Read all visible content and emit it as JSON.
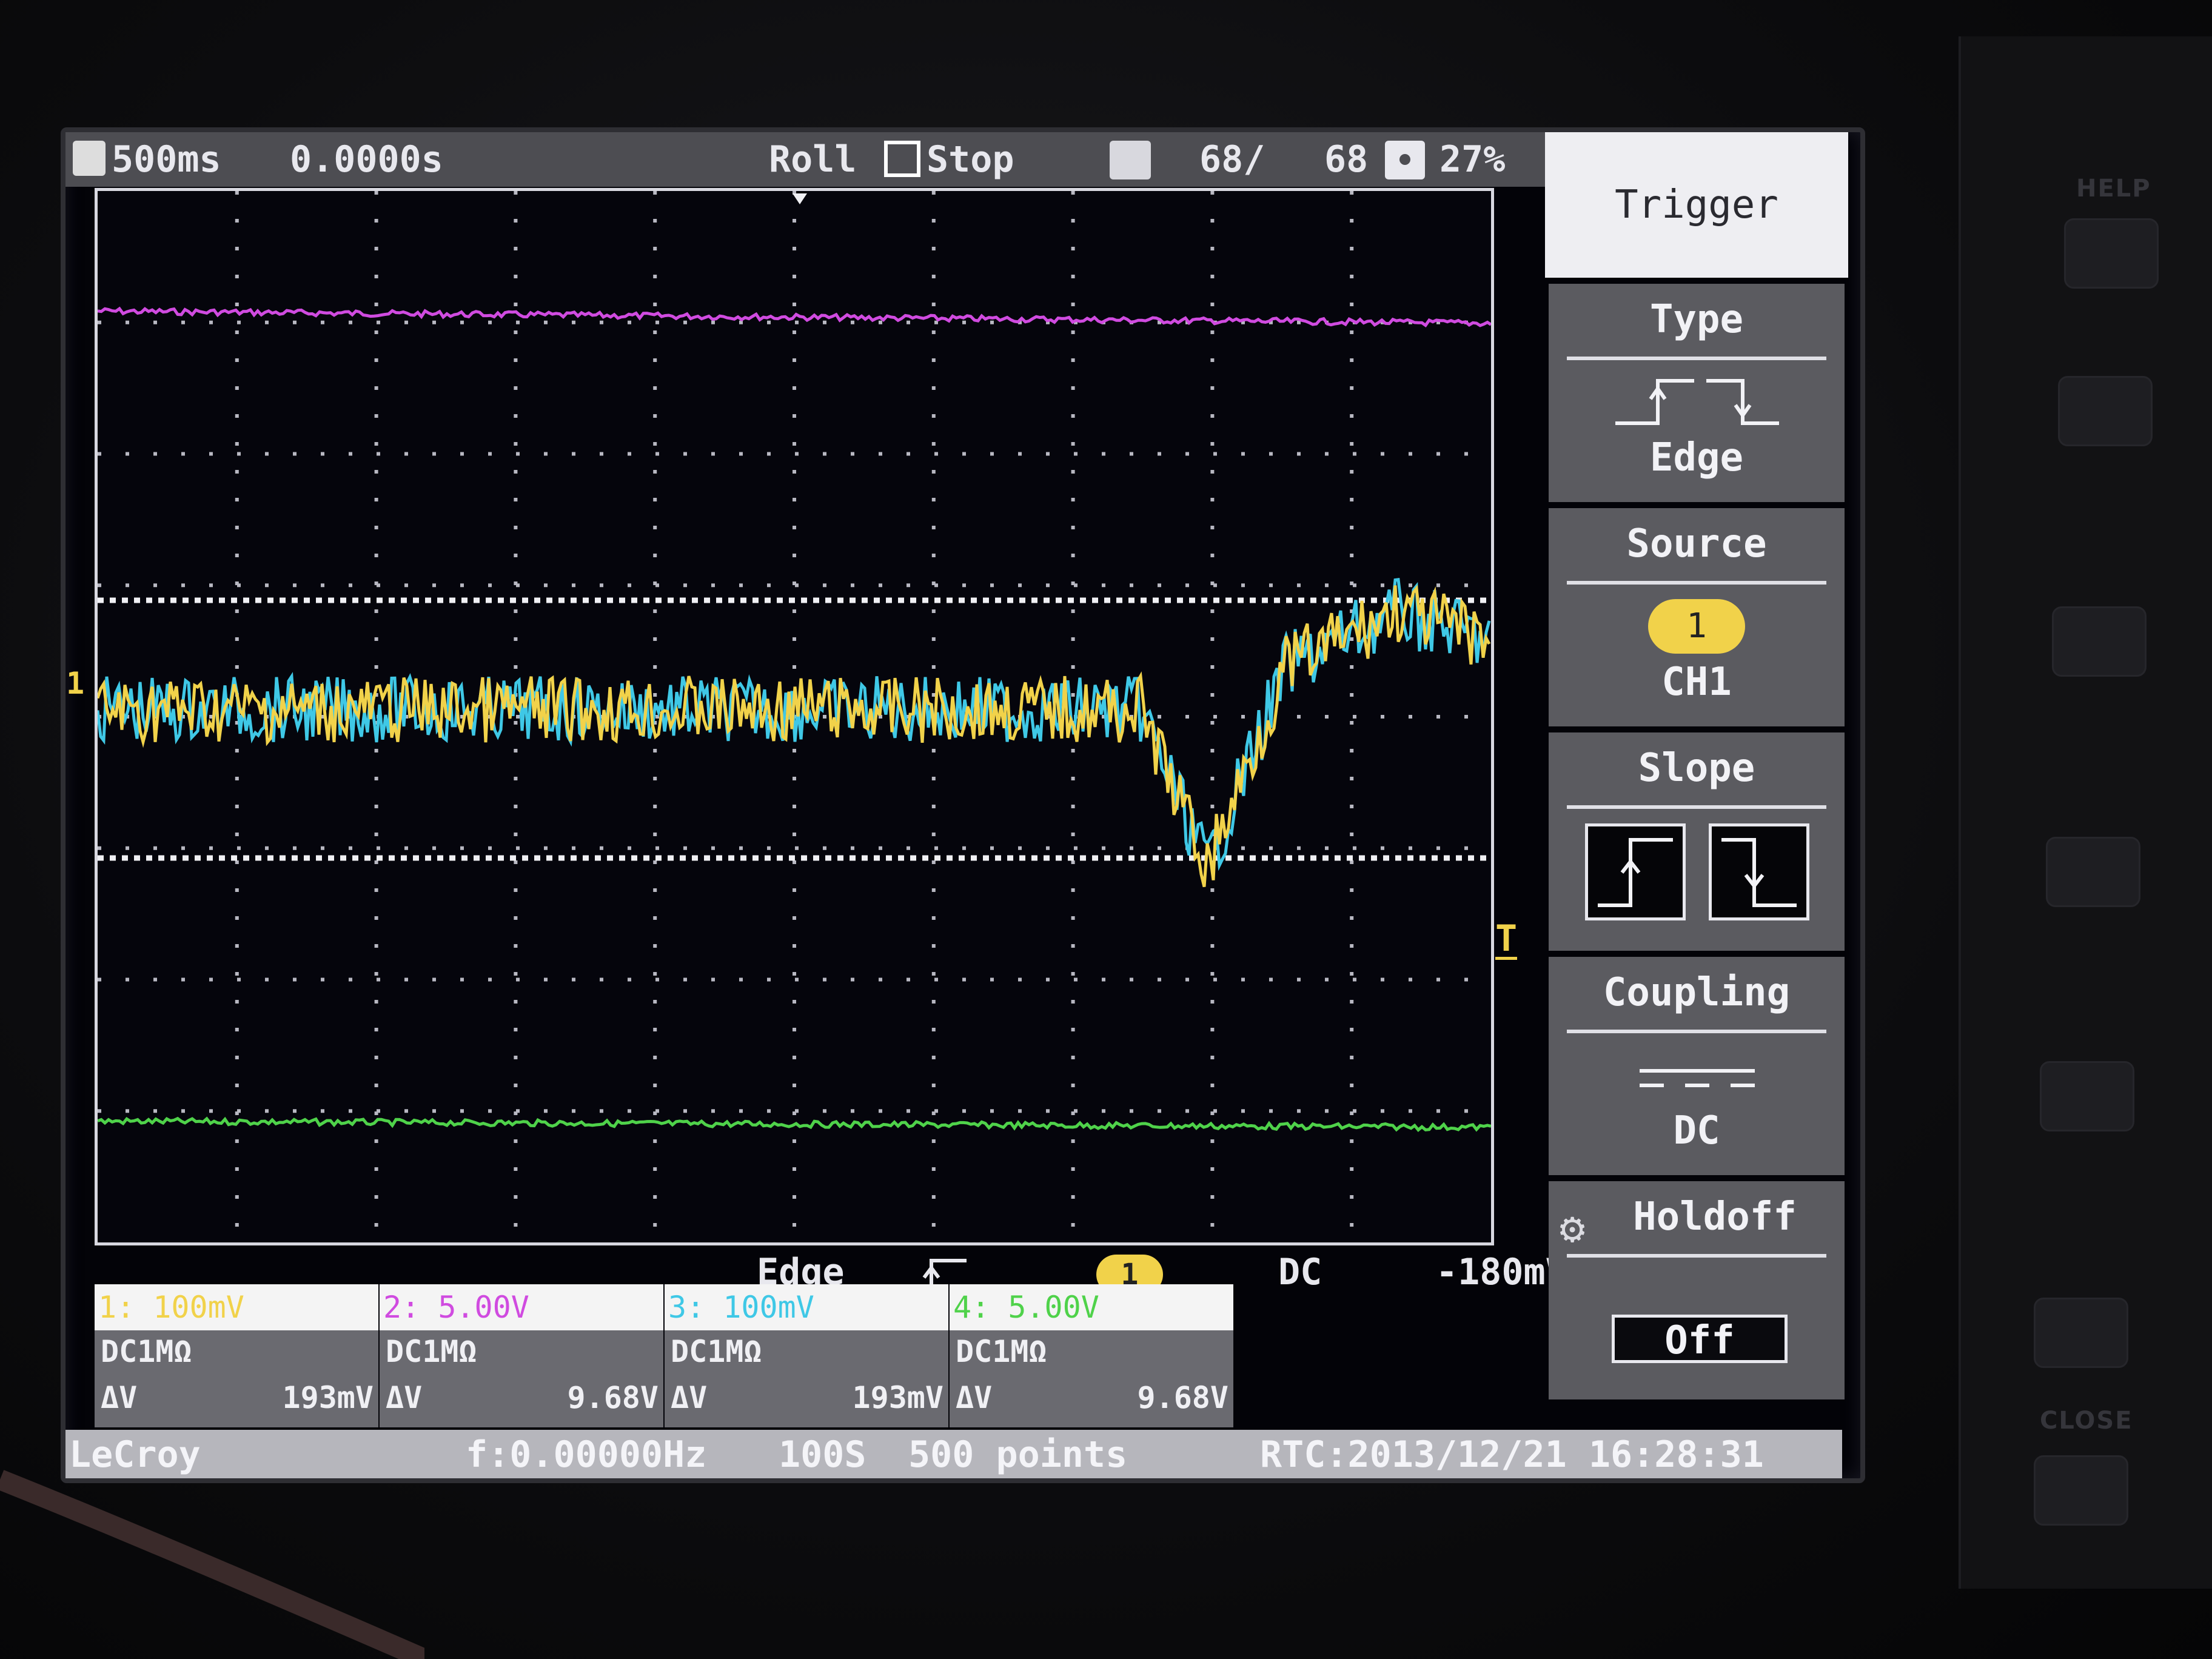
{
  "status_bar": {
    "timebase": "500ms",
    "delay": "0.0000s",
    "mode": "Roll",
    "run_state": "Stop",
    "acq_count": "68/",
    "acq_total": "68",
    "zoom_percent": "27%"
  },
  "trigger_readout": {
    "type": "Edge",
    "source": "1",
    "coupling": "DC",
    "level": "-180mV"
  },
  "channels": [
    {
      "name": "1:",
      "scale": "100mV",
      "coupling": "DC1MΩ",
      "dv_label": "ΔV",
      "dv": "193mV",
      "color": "#f1d24a"
    },
    {
      "name": "2:",
      "scale": "5.00V",
      "coupling": "DC1MΩ",
      "dv_label": "ΔV",
      "dv": "9.68V",
      "color": "#d04be0"
    },
    {
      "name": "3:",
      "scale": "100mV",
      "coupling": "DC1MΩ",
      "dv_label": "ΔV",
      "dv": "193mV",
      "color": "#3fc8e6"
    },
    {
      "name": "4:",
      "scale": "5.00V",
      "coupling": "DC1MΩ",
      "dv_label": "ΔV",
      "dv": "9.68V",
      "color": "#4fd24a"
    }
  ],
  "bottom_bar": {
    "brand": "LeCroy",
    "frequency": "f:0.00000Hz",
    "sample_rate": "100S",
    "record_length": "500 points",
    "rtc": "RTC:2013/12/21  16:28:31"
  },
  "trigger_menu": {
    "title": "Trigger",
    "type_label": "Type",
    "type_value": "Edge",
    "source_label": "Source",
    "source_badge": "1",
    "source_value": "CH1",
    "slope_label": "Slope",
    "coupling_label": "Coupling",
    "coupling_value": "DC",
    "holdoff_label": "Holdoff",
    "holdoff_value": "Off"
  },
  "panel_labels": {
    "help": "HELP",
    "close": "CLOSE"
  },
  "markers": {
    "ch1": "1",
    "trigger": "T"
  },
  "icons": {
    "trigger-slope-rising": "rising-edge-icon",
    "holdoff": "gear-icon",
    "stop": "stop-square-icon"
  },
  "trace_colors": {
    "ch1": "#f1d24a",
    "ch2": "#d04be0",
    "ch3": "#3fc8e6",
    "ch4": "#4fd24a"
  }
}
